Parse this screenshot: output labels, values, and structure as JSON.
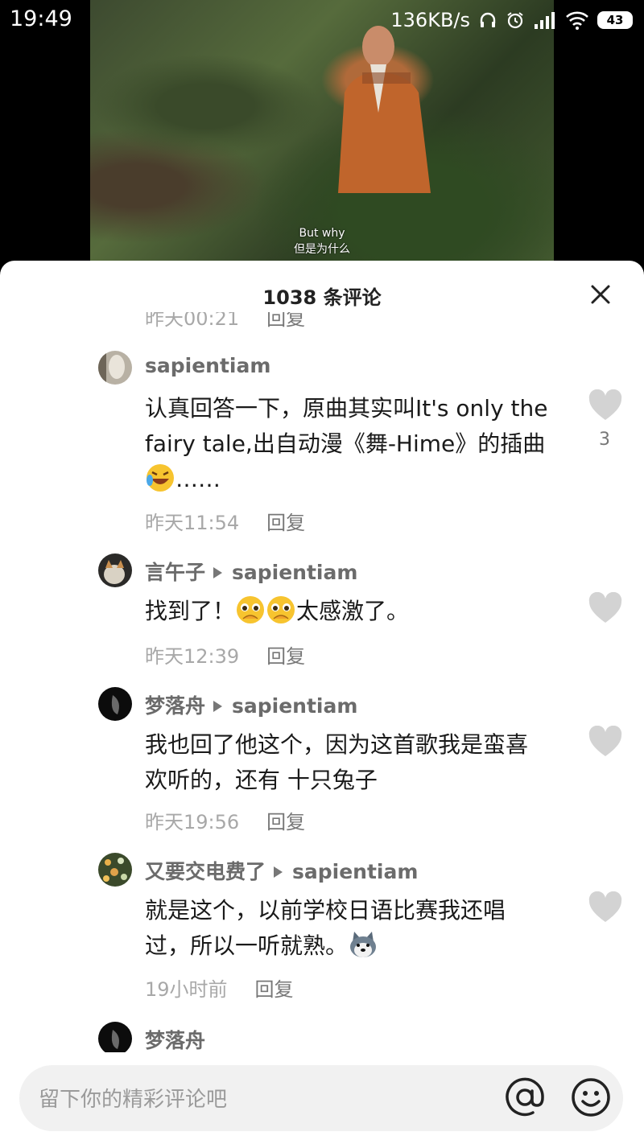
{
  "status_bar": {
    "time": "19:49",
    "speed": "136KB/s",
    "battery": "43"
  },
  "video": {
    "subtitle_en": "But why",
    "subtitle_zh": "但是为什么"
  },
  "comments_panel": {
    "title": "1038 条评论",
    "partial_top_meta": {
      "time": "昨天00:21",
      "reply": "回复"
    },
    "comments": [
      {
        "user": "sapientiam",
        "reply_to": "",
        "text_line1": "认真回答一下，原曲其实叫It's only the",
        "text_line2": "fairy tale,出自动漫《舞-Hime》的插曲",
        "text_line3": "……",
        "time": "昨天11:54",
        "reply": "回复",
        "likes": "3"
      },
      {
        "user": "言午子",
        "reply_to": "sapientiam",
        "text_before": "找到了！",
        "text_after": "太感激了。",
        "time": "昨天12:39",
        "reply": "回复"
      },
      {
        "user": "梦落舟",
        "reply_to": "sapientiam",
        "text_line1": "我也回了他这个，因为这首歌我是蛮喜",
        "text_line2": "欢听的，还有 十只兔子",
        "time": "昨天19:56",
        "reply": "回复"
      },
      {
        "user": "又要交电费了",
        "reply_to": "sapientiam",
        "text_line1": "就是这个，以前学校日语比赛我还唱",
        "text_line2": "过，所以一听就熟。",
        "time": "19小时前",
        "reply": "回复"
      },
      {
        "user": "梦落舟"
      }
    ]
  },
  "input_bar": {
    "placeholder": "留下你的精彩评论吧"
  },
  "colors": {
    "sheet_bg": "#ffffff",
    "username": "#6b6b6b",
    "meta": "#a8a8a8",
    "heart": "#cfcfcf",
    "input_bg": "#f1f1f1"
  }
}
